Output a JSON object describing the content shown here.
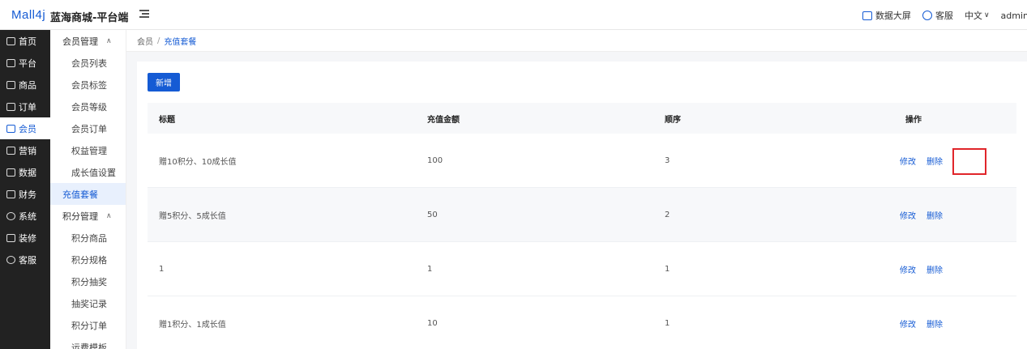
{
  "header": {
    "logo": "Mall4j",
    "app_title": "蓝海商城-平台端",
    "data_screen": "数据大屏",
    "customer_service": "客服",
    "language": "中文",
    "user": "admin"
  },
  "nav": {
    "items": [
      {
        "label": "首页",
        "icon": "home-icon"
      },
      {
        "label": "平台",
        "icon": "monitor-icon"
      },
      {
        "label": "商品",
        "icon": "box-icon"
      },
      {
        "label": "订单",
        "icon": "document-icon"
      },
      {
        "label": "会员",
        "icon": "users-icon",
        "active": true
      },
      {
        "label": "营销",
        "icon": "gift-icon"
      },
      {
        "label": "数据",
        "icon": "chart-icon"
      },
      {
        "label": "财务",
        "icon": "ledger-icon"
      },
      {
        "label": "系统",
        "icon": "gear-icon"
      },
      {
        "label": "装修",
        "icon": "brush-icon"
      },
      {
        "label": "客服",
        "icon": "chat-icon"
      }
    ]
  },
  "subnav": {
    "group1": "会员管理",
    "group1_items": [
      "会员列表",
      "会员标签",
      "会员等级",
      "会员订单",
      "权益管理",
      "成长值设置"
    ],
    "active_item": "充值套餐",
    "group2": "积分管理",
    "group2_items": [
      "积分商品",
      "积分规格",
      "积分抽奖",
      "抽奖记录",
      "积分订单",
      "运费模板"
    ]
  },
  "breadcrumb": {
    "root": "会员",
    "separator": "/",
    "current": "充值套餐"
  },
  "toolbar": {
    "add_label": "新增"
  },
  "table": {
    "columns": [
      "标题",
      "充值金额",
      "顺序",
      "操作"
    ],
    "edit_label": "修改",
    "delete_label": "删除",
    "rows": [
      {
        "title": "赠10积分、10成长值",
        "amount": "100",
        "order": "3"
      },
      {
        "title": "赠5积分、5成长值",
        "amount": "50",
        "order": "2"
      },
      {
        "title": "1",
        "amount": "1",
        "order": "1"
      },
      {
        "title": "赠1积分、1成长值",
        "amount": "10",
        "order": "1"
      }
    ]
  },
  "colors": {
    "accent": "#155bd4",
    "highlight": "#e0252a",
    "sidebar": "#222222"
  }
}
